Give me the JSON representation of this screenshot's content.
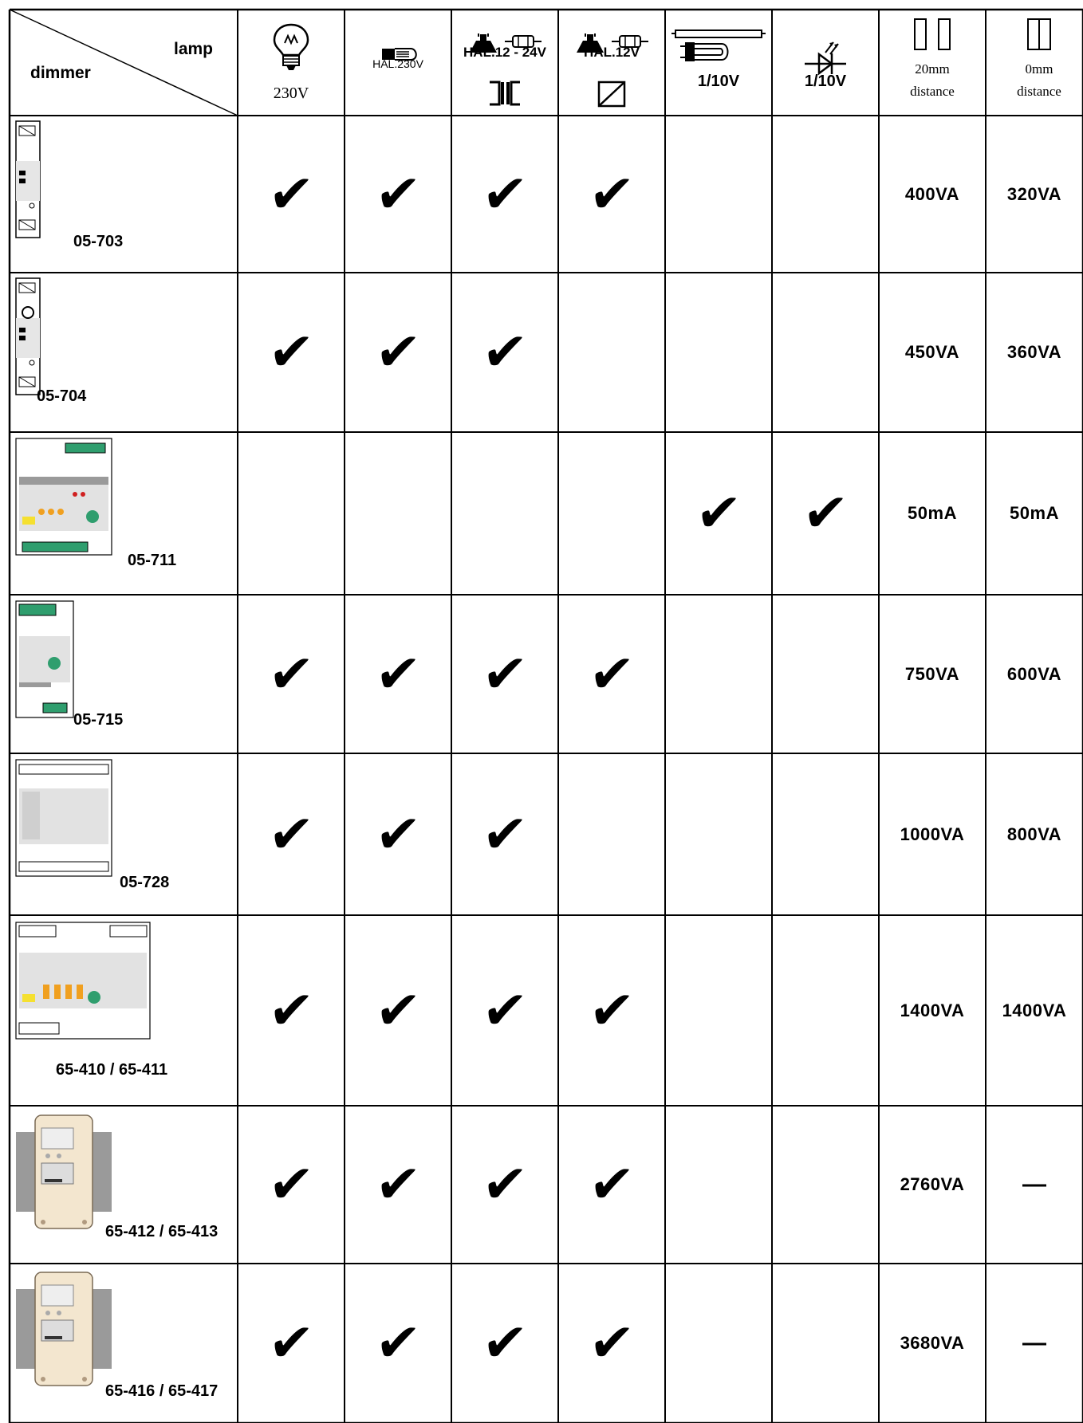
{
  "header": {
    "corner": {
      "lamp_label": "lamp",
      "dimmer_label": "dimmer"
    },
    "columns": [
      {
        "id": "incandescent",
        "icon": "incandescent-bulb-icon",
        "line1": "",
        "line2": "230V"
      },
      {
        "id": "halogen-230",
        "icon": "halogen-230v-icon",
        "line1": "HAL.230V",
        "line2": ""
      },
      {
        "id": "halogen-12-24",
        "icon": "halogen-spot-tube-icon",
        "line1": "HAL.12 - 24V",
        "line2": "",
        "sub_icon": "conventional-transformer-icon"
      },
      {
        "id": "halogen-12",
        "icon": "halogen-spot-tube-icon",
        "line1": "HAL.12V",
        "line2": "",
        "sub_icon": "electronic-transformer-icon"
      },
      {
        "id": "fluorescent",
        "icon": "fluorescent-tube-icon",
        "line1": "1/10V",
        "line2": ""
      },
      {
        "id": "led",
        "icon": "led-diode-icon",
        "line1": "1/10V",
        "line2": ""
      },
      {
        "id": "dist-20",
        "icon": "two-modules-spaced-icon",
        "line1": "20mm",
        "line2": "distance"
      },
      {
        "id": "dist-0",
        "icon": "two-modules-adjacent-icon",
        "line1": "0mm",
        "line2": "distance"
      }
    ]
  },
  "rows": [
    {
      "model": "05-703",
      "device_icon": "dimmer-module-icon",
      "checks": [
        true,
        true,
        true,
        true,
        false,
        false
      ],
      "rating_20mm": "400VA",
      "rating_0mm": "320VA"
    },
    {
      "model": "05-704",
      "device_icon": "dimmer-module-rotary-icon",
      "checks": [
        true,
        true,
        true,
        false,
        false,
        false
      ],
      "rating_20mm": "450VA",
      "rating_0mm": "360VA"
    },
    {
      "model": "05-711",
      "device_icon": "dimmer-controller-1-10v-icon",
      "checks": [
        false,
        false,
        false,
        false,
        true,
        true
      ],
      "rating_20mm": "50mA",
      "rating_0mm": "50mA"
    },
    {
      "model": "05-715",
      "device_icon": "universal-dimmer-module-icon",
      "checks": [
        true,
        true,
        true,
        true,
        false,
        false
      ],
      "rating_20mm": "750VA",
      "rating_0mm": "600VA"
    },
    {
      "model": "05-728",
      "device_icon": "dimmer-module-wide-icon",
      "checks": [
        true,
        true,
        true,
        false,
        false,
        false
      ],
      "rating_20mm": "1000VA",
      "rating_0mm": "800VA"
    },
    {
      "model": "65-410 / 65-411",
      "device_icon": "universal-dimmer-wide-icon",
      "checks": [
        true,
        true,
        true,
        true,
        false,
        false
      ],
      "rating_20mm": "1400VA",
      "rating_0mm": "1400VA"
    },
    {
      "model": "65-412 / 65-413",
      "device_icon": "power-dimmer-heatsink-icon",
      "checks": [
        true,
        true,
        true,
        true,
        false,
        false
      ],
      "rating_20mm": "2760VA",
      "rating_0mm": "—"
    },
    {
      "model": "65-416 / 65-417",
      "device_icon": "power-dimmer-heatsink-icon",
      "checks": [
        true,
        true,
        true,
        true,
        false,
        false
      ],
      "rating_20mm": "3680VA",
      "rating_0mm": "—"
    }
  ],
  "symbols": {
    "check": "✔"
  }
}
